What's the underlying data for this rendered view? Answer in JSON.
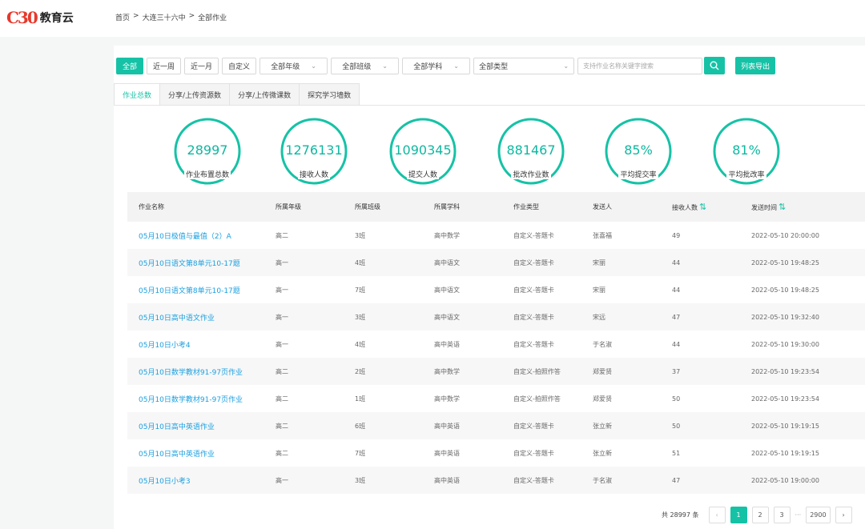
{
  "brand": {
    "mark": "C30",
    "name": "教育云"
  },
  "breadcrumb": [
    "首页",
    ">",
    "大连三十六中",
    ">",
    "全部作业"
  ],
  "filters": {
    "time_buttons": [
      "全部",
      "近一周",
      "近一月",
      "自定义"
    ],
    "selects": [
      "全部年级",
      "全部班级",
      "全部学科",
      "全部类型"
    ],
    "search_placeholder": "支持作业名称关键字搜索",
    "export_label": "列表导出"
  },
  "tabs": [
    "作业总数",
    "分享/上传资源数",
    "分享/上传微课数",
    "探究学习墙数"
  ],
  "stats": [
    {
      "value": "28997",
      "label": "作业布置总数"
    },
    {
      "value": "1276131",
      "label": "接收人数"
    },
    {
      "value": "1090345",
      "label": "提交人数"
    },
    {
      "value": "881467",
      "label": "批改作业数"
    },
    {
      "value": "85%",
      "label": "平均提交率"
    },
    {
      "value": "81%",
      "label": "平均批改率"
    }
  ],
  "table": {
    "headers": [
      "作业名称",
      "所属年级",
      "所属班级",
      "所属学科",
      "作业类型",
      "发送人",
      "接收人数",
      "发送时间"
    ],
    "rows": [
      [
        "05月10日极值与最值（2）A",
        "高二",
        "3班",
        "高中数学",
        "自定义-答题卡",
        "张喜福",
        "49",
        "2022-05-10 20:00:00"
      ],
      [
        "05月10日语文第8单元10-17题",
        "高一",
        "4班",
        "高中语文",
        "自定义-答题卡",
        "宋丽",
        "44",
        "2022-05-10 19:48:25"
      ],
      [
        "05月10日语文第8单元10-17题",
        "高一",
        "7班",
        "高中语文",
        "自定义-答题卡",
        "宋丽",
        "44",
        "2022-05-10 19:48:25"
      ],
      [
        "05月10日高中语文作业",
        "高一",
        "3班",
        "高中语文",
        "自定义-答题卡",
        "宋远",
        "47",
        "2022-05-10 19:32:40"
      ],
      [
        "05月10日小考4",
        "高一",
        "4班",
        "高中英语",
        "自定义-答题卡",
        "于名淑",
        "44",
        "2022-05-10 19:30:00"
      ],
      [
        "05月10日数学教材91-97页作业",
        "高二",
        "2班",
        "高中数学",
        "自定义-拍照作答",
        "郑爱贤",
        "37",
        "2022-05-10 19:23:54"
      ],
      [
        "05月10日数学教材91-97页作业",
        "高二",
        "1班",
        "高中数学",
        "自定义-拍照作答",
        "郑爱贤",
        "50",
        "2022-05-10 19:23:54"
      ],
      [
        "05月10日高中英语作业",
        "高二",
        "6班",
        "高中英语",
        "自定义-答题卡",
        "张立新",
        "50",
        "2022-05-10 19:19:15"
      ],
      [
        "05月10日高中英语作业",
        "高二",
        "7班",
        "高中英语",
        "自定义-答题卡",
        "张立新",
        "51",
        "2022-05-10 19:19:15"
      ],
      [
        "05月10日小考3",
        "高一",
        "3班",
        "高中英语",
        "自定义-答题卡",
        "于名淑",
        "47",
        "2022-05-10 19:00:00"
      ]
    ]
  },
  "pagination": {
    "total": "共 28997 条",
    "pages": [
      "1",
      "2",
      "3"
    ],
    "ellipsis": "···",
    "last": "2900",
    "prev": "‹",
    "next": "›"
  },
  "colors": {
    "accent": "#16c2a6",
    "link": "#1a9fe0",
    "brand_red": "#e8382b"
  },
  "icons": {
    "search": "search-icon",
    "sort": "sort-icon",
    "prev": "chevron-left-icon",
    "next": "chevron-right-icon"
  }
}
